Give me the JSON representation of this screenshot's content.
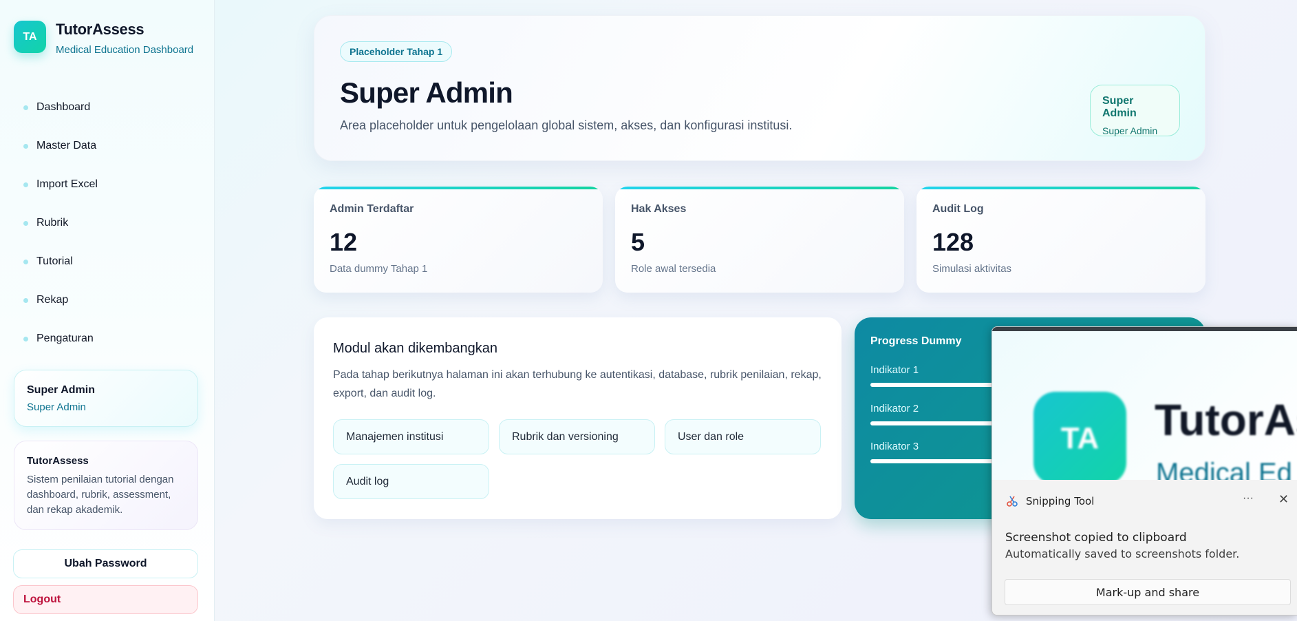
{
  "brand": {
    "logo_text": "TA",
    "title": "TutorAssess",
    "subtitle": "Medical Education Dashboard"
  },
  "nav": [
    {
      "label": "Dashboard"
    },
    {
      "label": "Master Data"
    },
    {
      "label": "Import Excel"
    },
    {
      "label": "Rubrik"
    },
    {
      "label": "Tutorial"
    },
    {
      "label": "Rekap"
    },
    {
      "label": "Pengaturan"
    }
  ],
  "user_card": {
    "name": "Super Admin",
    "role": "Super Admin"
  },
  "info_card": {
    "title": "TutorAssess",
    "description": "Sistem penilaian tutorial dengan dashboard, rubrik, assessment, dan rekap akademik."
  },
  "buttons": {
    "change_password": "Ubah Password",
    "logout": "Logout"
  },
  "hero": {
    "badge": "Placeholder Tahap 1",
    "title": "Super Admin",
    "description": "Area placeholder untuk pengelolaan global sistem, akses, dan konfigurasi institusi.",
    "pill_title": "Super Admin",
    "pill_subtitle": "Super Admin"
  },
  "stats": [
    {
      "label": "Admin Terdaftar",
      "value": "12",
      "sub": "Data dummy Tahap 1"
    },
    {
      "label": "Hak Akses",
      "value": "5",
      "sub": "Role awal tersedia"
    },
    {
      "label": "Audit Log",
      "value": "128",
      "sub": "Simulasi aktivitas"
    }
  ],
  "module": {
    "title": "Modul akan dikembangkan",
    "description": "Pada tahap berikutnya halaman ini akan terhubung ke autentikasi, database, rubrik penilaian, rekap, export, dan audit log.",
    "chips": [
      "Manajemen institusi",
      "Rubrik dan versioning",
      "User dan role",
      "Audit log"
    ]
  },
  "progress": {
    "title": "Progress Dummy",
    "items": [
      {
        "label": "Indikator 1",
        "fraction": 0.8
      },
      {
        "label": "Indikator 2",
        "fraction": 0.65
      },
      {
        "label": "Indikator 3",
        "fraction": 0.5
      }
    ]
  },
  "snipping_tool": {
    "app_name": "Snipping Tool",
    "more_icon": "more-icon",
    "close_icon": "close-icon",
    "message": "Screenshot copied to clipboard",
    "submessage": "Automatically saved to screenshots folder.",
    "action": "Mark-up and share",
    "preview": {
      "logo_text": "TA",
      "title": "TutorAs",
      "subtitle": "Medical Ed"
    }
  },
  "colors": {
    "accent_teal": "#14d3a0",
    "accent_cyan": "#22d3ee",
    "brand_text": "#0e7490",
    "logout": "#be123c"
  }
}
